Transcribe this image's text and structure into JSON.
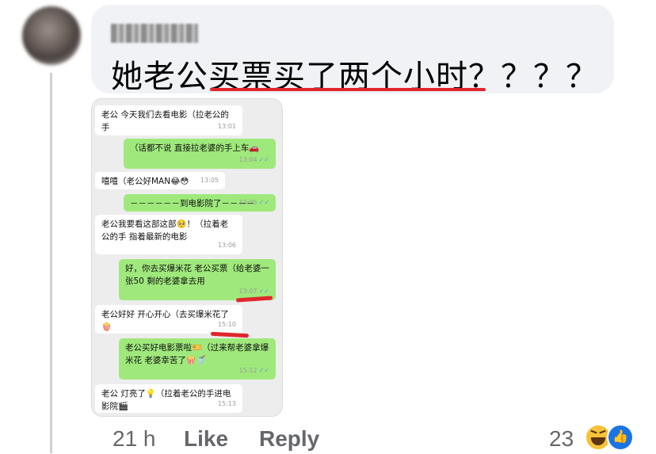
{
  "comment": {
    "author": "",
    "text": "她老公买票买了两个小时？？？？",
    "timestamp": "21 h",
    "like_label": "Like",
    "reply_label": "Reply",
    "reaction_count": "23",
    "reaction_icons": [
      "haha-icon",
      "like-thumb-icon"
    ]
  },
  "chat": {
    "messages": [
      {
        "side": "in",
        "text": "老公 今天我们去看电影（拉老公的手",
        "time": "13:01"
      },
      {
        "side": "out",
        "text": "（话都不说 直接拉老婆的手上车🚗",
        "time": "13:04",
        "read": "✓✓"
      },
      {
        "side": "in",
        "text": "嘻嘻（老公好MAN😂😳",
        "time": "13:05"
      },
      {
        "side": "out",
        "text": "－－－－－－到电影院了－－－－",
        "time": "13:05",
        "read": "✓✓"
      },
      {
        "side": "in",
        "text": "老公我要看这部这部🥺！（拉着老公的手 指着最新的电影",
        "time": "13:06"
      },
      {
        "side": "out",
        "text": "好，你去买爆米花 老公买票（给老婆一张50 剩的老婆拿去用",
        "time": "13:07",
        "read": "✓✓"
      },
      {
        "side": "in",
        "text": "老公好好 开心开心（去买爆米花了🍿",
        "time": "15:10"
      },
      {
        "side": "out",
        "text": "老公买好电影票啦🎫（过来帮老婆拿爆米花 老婆幸苦了🍿🥤",
        "time": "15:12",
        "read": "✓✓"
      },
      {
        "side": "in",
        "text": "老公 灯亮了💡（拉着老公的手进电影院🎬",
        "time": "15:13"
      }
    ]
  },
  "colors": {
    "bubble_bg": "#f0f2f5",
    "underline_red": "#e0262c",
    "chat_out": "#9fe97c",
    "chat_in": "#ffffff",
    "like_blue": "#1b74e4"
  }
}
